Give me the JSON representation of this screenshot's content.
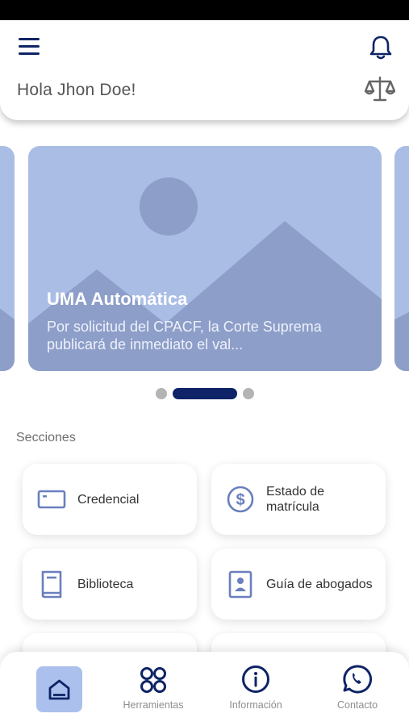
{
  "header": {
    "greeting": "Hola Jhon Doe!",
    "menu_icon": "hamburger-menu-icon",
    "notification_icon": "bell-icon",
    "brand_icon": "scales-of-justice-icon"
  },
  "carousel": {
    "slides": [
      {
        "title": "UMA Automática",
        "body": "Por solicitud del CPACF, la Corte Suprema publicará de inmediato el val..."
      }
    ],
    "active_index": 1,
    "dot_count": 3
  },
  "sections": {
    "label": "Secciones",
    "items": [
      {
        "label": "Credencial",
        "icon": "id-card-icon"
      },
      {
        "label": "Estado de matrícula",
        "icon": "dollar-circle-icon"
      },
      {
        "label": "Biblioteca",
        "icon": "book-icon"
      },
      {
        "label": "Guía de abogados",
        "icon": "contact-book-icon"
      }
    ]
  },
  "bottom_nav": {
    "items": [
      {
        "label": "",
        "icon": "home-icon",
        "active": true
      },
      {
        "label": "Herramientas",
        "icon": "grid-circles-icon"
      },
      {
        "label": "Información",
        "icon": "info-icon"
      },
      {
        "label": "Contacto",
        "icon": "whatsapp-icon"
      }
    ]
  },
  "colors": {
    "primary": "#0e2466",
    "slide_bg": "#aabde5",
    "icon_accent": "#6a7fbf",
    "home_active_bg": "#abc0ec"
  }
}
